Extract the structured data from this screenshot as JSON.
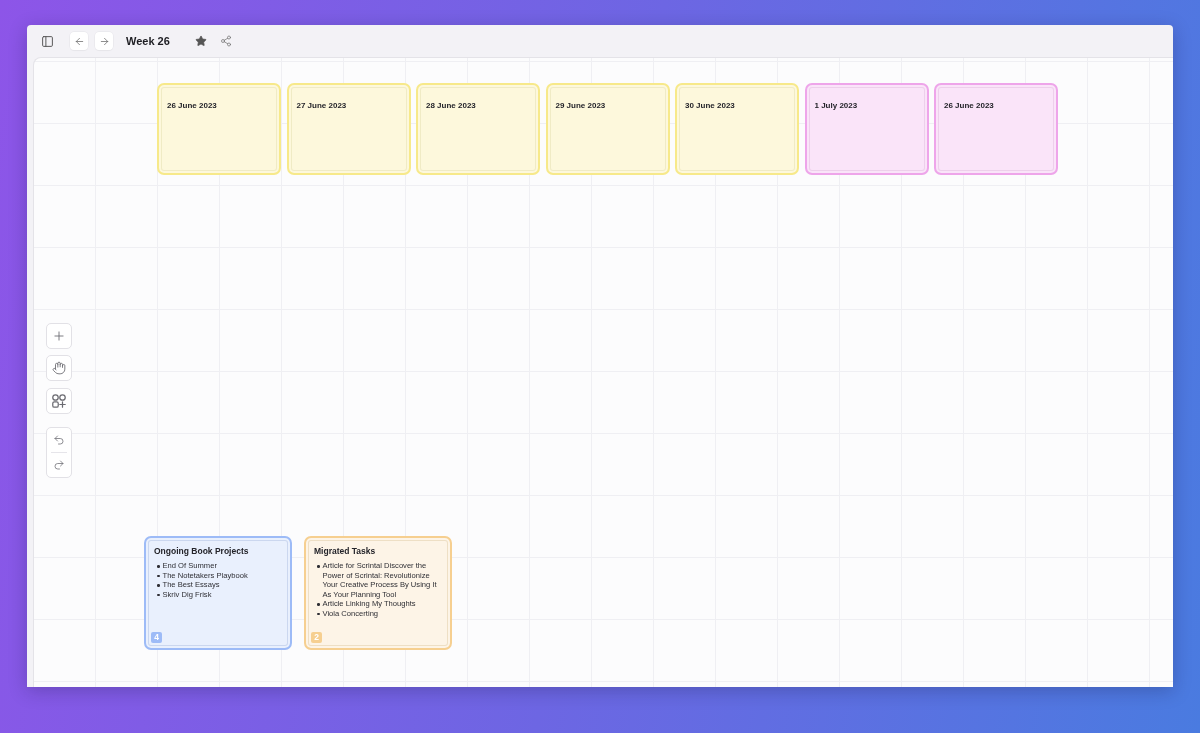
{
  "top_bar": {
    "title": "Week 26"
  },
  "day_cards": [
    {
      "date": "26 June 2023",
      "color": "#f7e98a"
    },
    {
      "date": "27 June 2023",
      "color": "#f7e98a"
    },
    {
      "date": "28 June 2023",
      "color": "#f7e98a"
    },
    {
      "date": "29 June 2023",
      "color": "#f7e98a"
    },
    {
      "date": "30 June 2023",
      "color": "#f7e98a"
    },
    {
      "date": "1 July 2023",
      "color": "#eea5ea"
    },
    {
      "date": "26 June 2023",
      "color": "#eea5ea"
    }
  ],
  "notes": [
    {
      "title": "Ongoing Book Projects",
      "color": "#9dbbf7",
      "items": [
        "End Of Summer",
        "The Notetakers Playbook",
        "The Best Essays",
        "Skriv Dig Frisk"
      ],
      "count": "4"
    },
    {
      "title": "Migrated Tasks",
      "color": "#f6cf90",
      "items": [
        "Article for Scrintal Discover the Power of Scrintal: Revolutionize Your Creative Process By Using It As Your Planning Tool",
        "Article Linking My Thoughts",
        "Viola Concerting"
      ],
      "count": "2"
    }
  ]
}
